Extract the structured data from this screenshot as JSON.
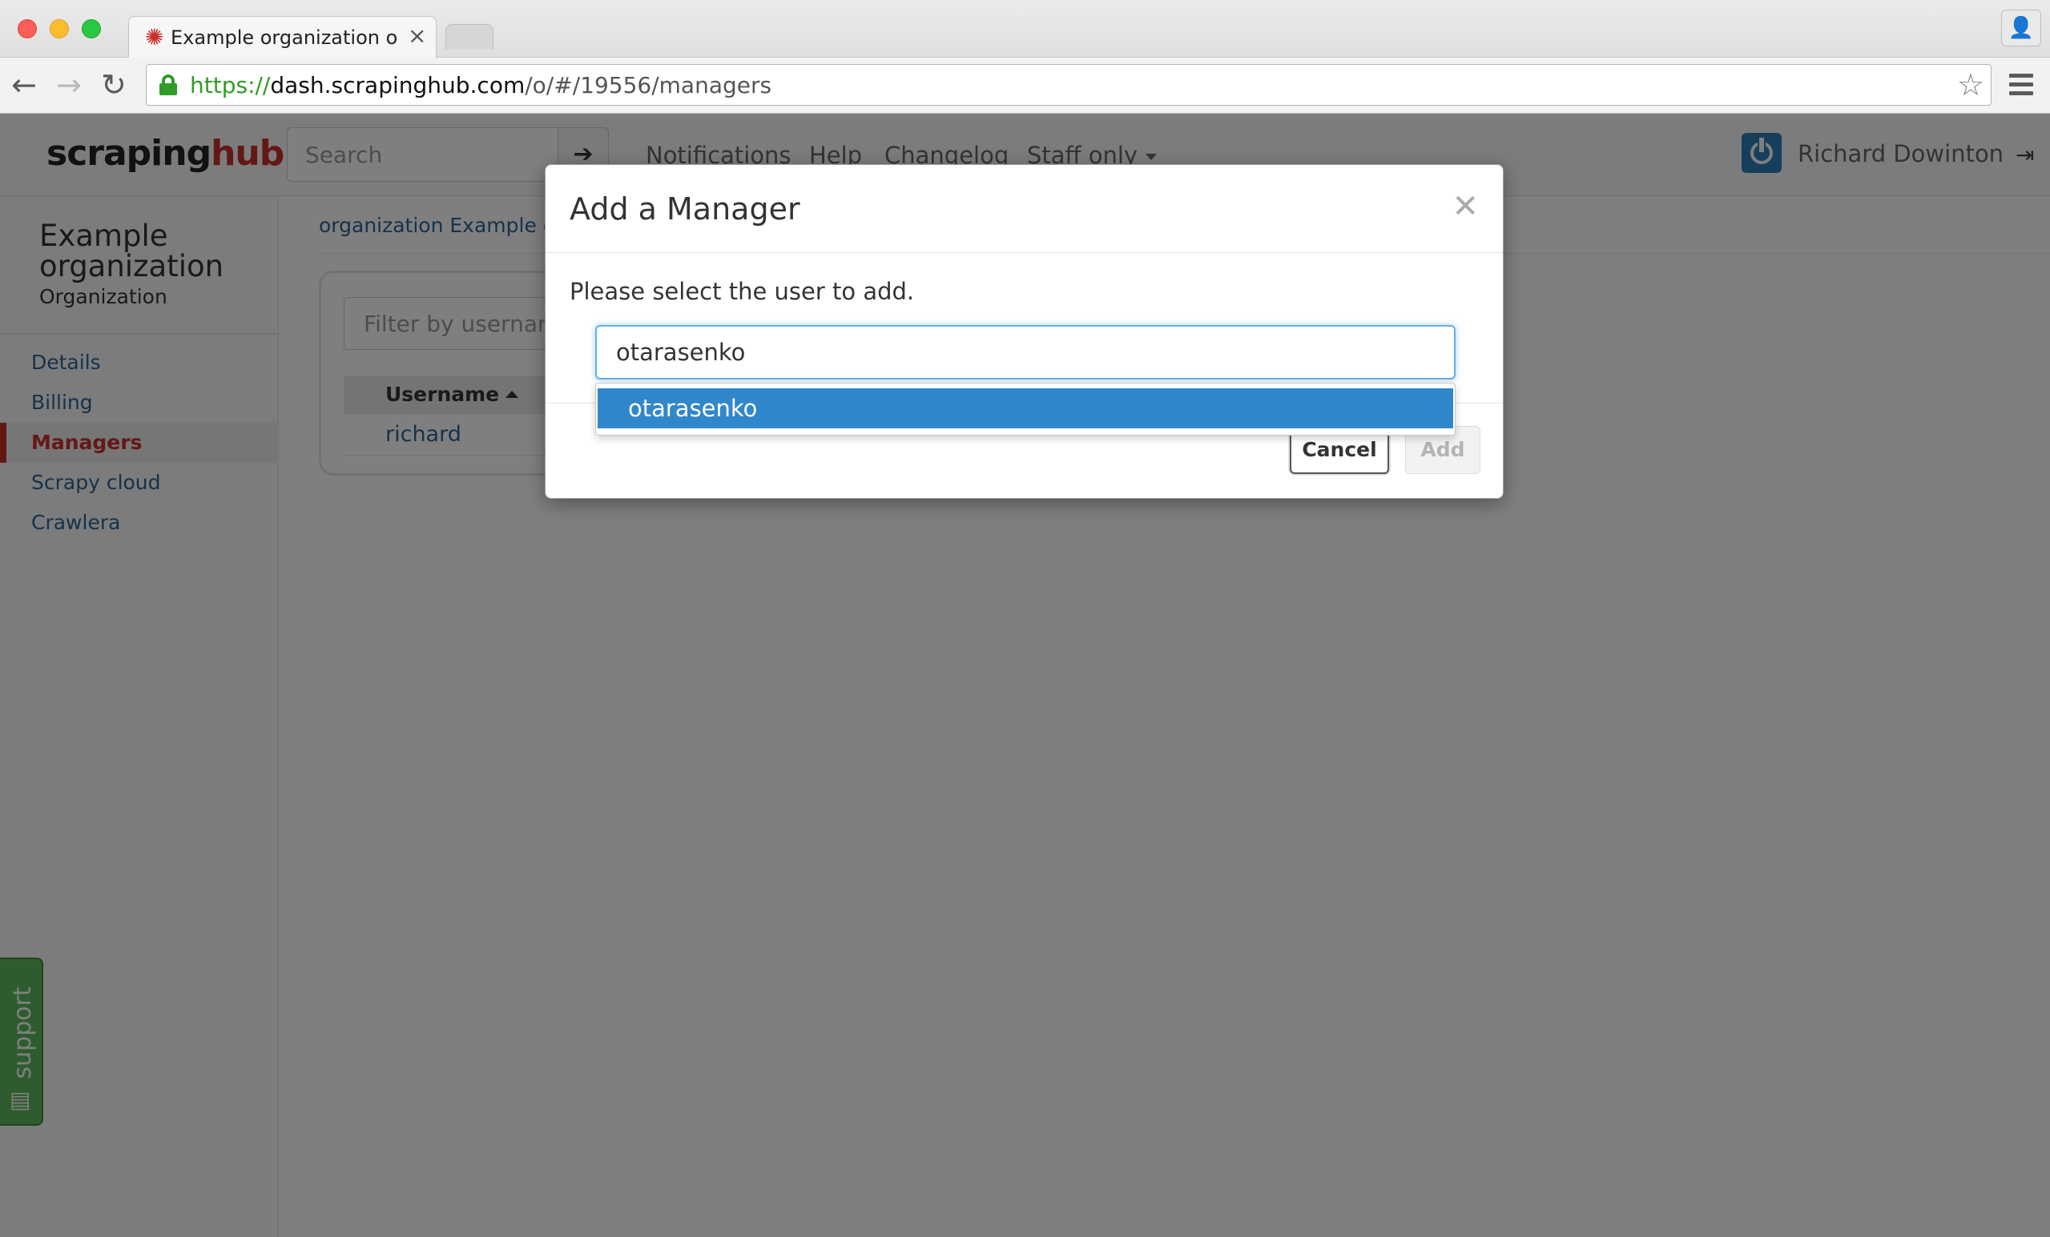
{
  "browser": {
    "tab_title": "Example organization organization",
    "url_scheme": "https://",
    "url_host": "dash.scrapinghub.com",
    "url_path": "/o/#/19556/managers"
  },
  "app_nav": {
    "logo_part1": "scraping",
    "logo_part2": "hub",
    "search_placeholder": "Search",
    "links": [
      "Notifications",
      "Help",
      "Changelog",
      "Staff only"
    ],
    "user_name": "Richard Dowinton"
  },
  "sidebar": {
    "org_name": "Example organization",
    "org_type": "Organization",
    "items": [
      {
        "label": "Details"
      },
      {
        "label": "Billing"
      },
      {
        "label": "Managers"
      },
      {
        "label": "Scrapy cloud"
      },
      {
        "label": "Crawlera"
      }
    ],
    "active_item": "Managers"
  },
  "main": {
    "breadcrumb": "organization Example or",
    "filter_placeholder": "Filter by usernam",
    "table": {
      "columns": [
        "Username"
      ],
      "rows": [
        [
          "richard"
        ]
      ]
    }
  },
  "support": {
    "label": "support"
  },
  "modal": {
    "title": "Add a Manager",
    "prompt": "Please select the user to add.",
    "input_value": "otarasenko",
    "suggestions": [
      "otarasenko"
    ],
    "cancel_label": "Cancel",
    "add_label": "Add"
  },
  "colors": {
    "brand_red": "#c9302c",
    "link_blue": "#2a6496",
    "highlight_blue": "#3187cb",
    "support_green": "#5cb85c"
  }
}
